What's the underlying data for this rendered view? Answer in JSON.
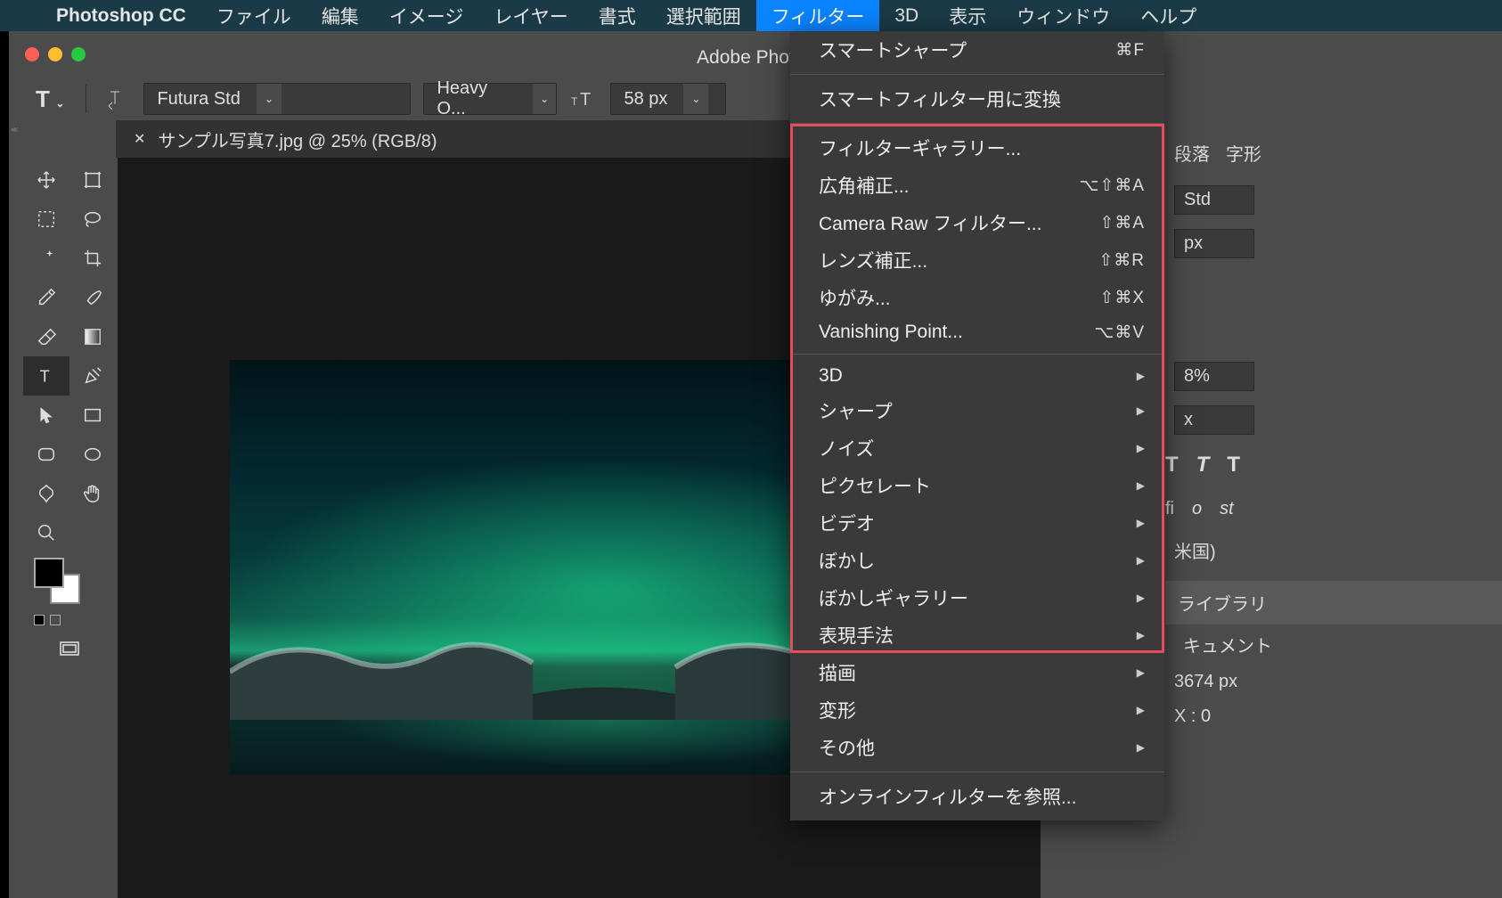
{
  "menubar": {
    "app": "Photoshop CC",
    "items": [
      "ファイル",
      "編集",
      "イメージ",
      "レイヤー",
      "書式",
      "選択範囲",
      "フィルター",
      "3D",
      "表示",
      "ウィンドウ",
      "ヘルプ"
    ],
    "active_index": 6
  },
  "window": {
    "title": "Adobe Photos"
  },
  "optionsbar": {
    "tool_letter": "T",
    "font_family": "Futura Std",
    "font_weight": "Heavy O...",
    "font_size": "58 px"
  },
  "document": {
    "tab_label": "サンプル写真7.jpg @ 25% (RGB/8)"
  },
  "tools": {
    "left": [
      "move",
      "marquee",
      "wand",
      "crop2",
      "eyedrop",
      "eraser",
      "type",
      "path",
      "shape",
      "custom",
      "zoom"
    ],
    "right": [
      "artboard",
      "lasso",
      "crop",
      "frame",
      "brush",
      "gradient",
      "pen",
      "rect",
      "ellipse",
      "hand"
    ],
    "selected": "type"
  },
  "filter_menu": {
    "last": {
      "label": "スマートシャープ",
      "shortcut": "⌘F"
    },
    "convert": "スマートフィルター用に変換",
    "group2": [
      {
        "label": "フィルターギャラリー...",
        "shortcut": ""
      },
      {
        "label": "広角補正...",
        "shortcut": "⌥⇧⌘A"
      },
      {
        "label": "Camera Raw フィルター...",
        "shortcut": "⇧⌘A"
      },
      {
        "label": "レンズ補正...",
        "shortcut": "⇧⌘R"
      },
      {
        "label": "ゆがみ...",
        "shortcut": "⇧⌘X"
      },
      {
        "label": "Vanishing Point...",
        "shortcut": "⌥⌘V"
      }
    ],
    "submenus": [
      "3D",
      "シャープ",
      "ノイズ",
      "ピクセレート",
      "ビデオ",
      "ぼかし",
      "ぼかしギャラリー",
      "表現手法",
      "描画",
      "変形",
      "その他"
    ],
    "browse": "オンラインフィルターを参照..."
  },
  "right_panel": {
    "tabs": [
      "段落",
      "字形"
    ],
    "font": "Std",
    "size": "px",
    "percent": "8%",
    "unit2": "x",
    "fmt": [
      "T",
      "T",
      "T"
    ],
    "glyph_row": [
      "fi",
      "o",
      "st"
    ],
    "locale": "米国)",
    "lib": "ライブラリ",
    "doc": "キュメント",
    "dim": "3674 px",
    "pos": "X : 0"
  }
}
